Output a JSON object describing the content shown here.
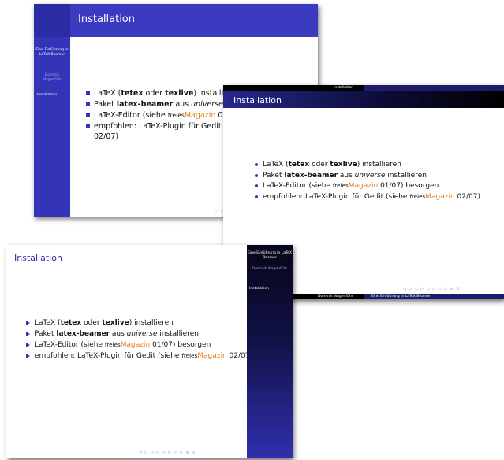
{
  "presentation": {
    "talk_title": "Eine Einführung in LaTeX Beamer",
    "author": "Dominik Wagenführ",
    "section": "Installation",
    "frame_title": "Installation",
    "nav_symbols": "◁ ▷ ◁ ▷ ◁ ▷ ◁ ▷   ≡   ↺",
    "bullets": [
      {
        "pre": "LaTeX (",
        "b1": "tetex",
        "mid": " oder ",
        "b2": "texlive",
        "post": ") installieren"
      },
      {
        "pre": "Paket ",
        "b1": "latex-beamer",
        "mid": " aus ",
        "em": "universe",
        "post": " installieren"
      },
      {
        "pre": "LaTeX-Editor (siehe ",
        "freies": "freies",
        "magazin": "Magazin",
        "post": " 01/07) besorgen"
      },
      {
        "pre": "empfohlen: LaTeX-Plugin für Gedit (siehe ",
        "freies": "freies",
        "magazin": "Magazin",
        "post": " 02/07)"
      }
    ]
  },
  "slide1": {
    "bullets": [
      {
        "pre": "LaTeX (",
        "b1": "tetex",
        "mid": " oder ",
        "b2": "texlive",
        "post": ") installi"
      },
      {
        "pre": "Paket ",
        "b1": "latex-beamer",
        "mid": " aus ",
        "em": "universe",
        "post": " i"
      },
      {
        "pre": "LaTeX-Editor (siehe ",
        "freies": "freies",
        "magazin": "Magazin",
        "post": " 0"
      },
      {
        "pre": "empfohlen: LaTeX-Plugin für Gedit",
        "post2": "02/07)"
      }
    ]
  },
  "colors": {
    "theme_blue": "#3434b8",
    "magazin_orange": "#e8801a",
    "dark": "#000000"
  }
}
